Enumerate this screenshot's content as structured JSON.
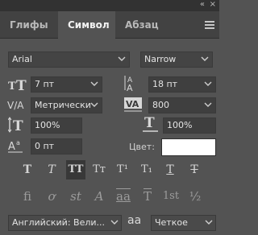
{
  "titlebar": {
    "collapse_icon": "«",
    "close_icon": "×"
  },
  "tabs": [
    {
      "label": "Глифы",
      "active": false
    },
    {
      "label": "Символ",
      "active": true
    },
    {
      "label": "Абзац",
      "active": false
    }
  ],
  "font": {
    "family": "Arial",
    "style": "Narrow"
  },
  "size": {
    "font_size": "7 пт",
    "leading": "18 пт"
  },
  "spacing": {
    "kerning": "Метрически",
    "tracking": "800"
  },
  "scale": {
    "vertical": "100%",
    "horizontal": "100%"
  },
  "baseline": {
    "shift": "0 пт"
  },
  "color": {
    "label": "Цвет:",
    "value": "#ffffff"
  },
  "type_buttons": [
    {
      "glyph": "T",
      "name": "faux-bold"
    },
    {
      "glyph": "T",
      "name": "faux-italic"
    },
    {
      "glyph": "TT",
      "name": "all-caps"
    },
    {
      "glyph": "Tт",
      "name": "small-caps"
    },
    {
      "glyph": "T¹",
      "name": "superscript"
    },
    {
      "glyph": "T₁",
      "name": "subscript"
    },
    {
      "glyph": "T",
      "name": "underline"
    },
    {
      "glyph": "T",
      "name": "strikethrough"
    }
  ],
  "opentype_buttons": [
    {
      "glyph": "fi",
      "name": "ligatures"
    },
    {
      "glyph": "ơ",
      "name": "discretionary-ligatures"
    },
    {
      "glyph": "st",
      "name": "swash"
    },
    {
      "glyph": "A",
      "name": "stylistic-alternates"
    },
    {
      "glyph": "aa",
      "name": "titling-alternates"
    },
    {
      "glyph": "T",
      "name": "ordinals"
    },
    {
      "glyph": "1st",
      "name": "ordinal-numbers"
    },
    {
      "glyph": "½",
      "name": "fractions"
    }
  ],
  "language": {
    "value": "Английский: Вели..."
  },
  "antialias": {
    "icon": "aa",
    "value": "Четкое"
  }
}
